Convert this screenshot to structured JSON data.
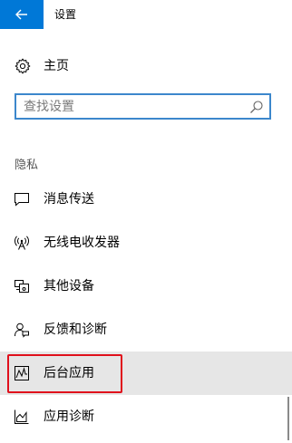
{
  "window": {
    "title": "设置"
  },
  "colors": {
    "accent": "#0078d7",
    "search_border": "#3c87cc",
    "selected_bg": "#e6e6e6",
    "highlight": "#e0101c"
  },
  "home": {
    "label": "主页",
    "icon": "gear-icon"
  },
  "search": {
    "placeholder": "查找设置",
    "value": "",
    "icon": "search-icon"
  },
  "section": {
    "header": "隐私"
  },
  "nav": {
    "items": [
      {
        "label": "消息传送",
        "icon": "message-icon",
        "selected": false
      },
      {
        "label": "无线电收发器",
        "icon": "radio-antenna-icon",
        "selected": false
      },
      {
        "label": "其他设备",
        "icon": "devices-icon",
        "selected": false
      },
      {
        "label": "反馈和诊断",
        "icon": "feedback-icon",
        "selected": false
      },
      {
        "label": "后台应用",
        "icon": "background-apps-icon",
        "selected": true,
        "highlighted": true
      },
      {
        "label": "应用诊断",
        "icon": "app-diagnostics-icon",
        "selected": false
      }
    ]
  }
}
